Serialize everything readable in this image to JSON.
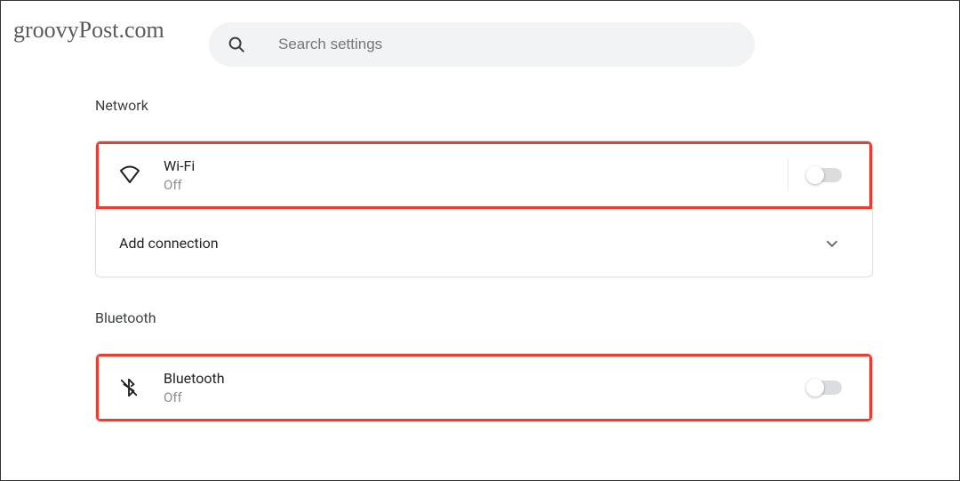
{
  "watermark": "groovyPost.com",
  "search": {
    "placeholder": "Search settings"
  },
  "sections": {
    "network": {
      "title": "Network",
      "wifi": {
        "label": "Wi-Fi",
        "status": "Off"
      },
      "addConnection": {
        "label": "Add connection"
      }
    },
    "bluetooth": {
      "title": "Bluetooth",
      "bt": {
        "label": "Bluetooth",
        "status": "Off"
      }
    }
  }
}
